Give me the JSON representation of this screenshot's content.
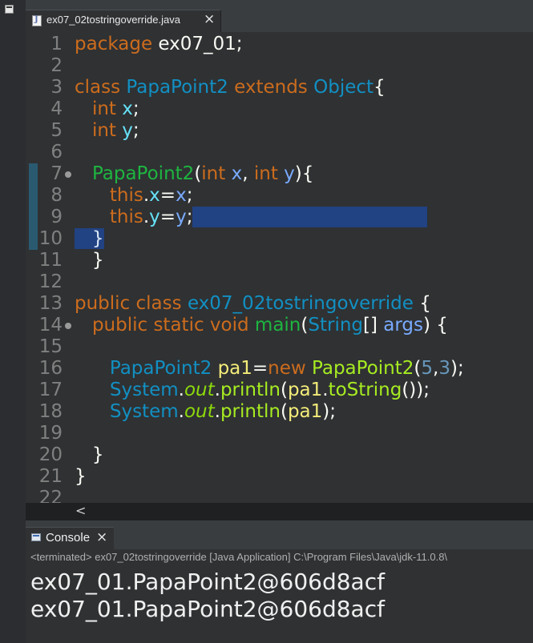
{
  "editor_tab": {
    "title": "ex07_02tostringoverride.java",
    "close": "×",
    "icon": "java-file-icon"
  },
  "code_lines": [
    {
      "n": "1",
      "t": [
        [
          "k",
          "package"
        ],
        [
          "p",
          " ex07_01;"
        ]
      ]
    },
    {
      "n": "2",
      "t": []
    },
    {
      "n": "3",
      "t": [
        [
          "k",
          "class"
        ],
        [
          "p",
          " "
        ],
        [
          "cl",
          "PapaPoint2"
        ],
        [
          "p",
          " "
        ],
        [
          "k",
          "extends"
        ],
        [
          "p",
          " "
        ],
        [
          "cl",
          "Object"
        ],
        [
          "p",
          "{"
        ]
      ]
    },
    {
      "n": "4",
      "t": [
        [
          "p",
          "   "
        ],
        [
          "k",
          "int"
        ],
        [
          "p",
          " "
        ],
        [
          "fd",
          "x"
        ],
        [
          "p",
          ";"
        ]
      ]
    },
    {
      "n": "5",
      "t": [
        [
          "p",
          "   "
        ],
        [
          "k",
          "int"
        ],
        [
          "p",
          " "
        ],
        [
          "fd",
          "y"
        ],
        [
          "p",
          ";"
        ]
      ]
    },
    {
      "n": "6",
      "t": []
    },
    {
      "n": "7",
      "t": [
        [
          "p",
          "   "
        ],
        [
          "fn",
          "PapaPoint2"
        ],
        [
          "p",
          "("
        ],
        [
          "k",
          "int"
        ],
        [
          "p",
          " "
        ],
        [
          "pm",
          "x"
        ],
        [
          "p",
          ", "
        ],
        [
          "k",
          "int"
        ],
        [
          "p",
          " "
        ],
        [
          "pm",
          "y"
        ],
        [
          "p",
          "){"
        ]
      ]
    },
    {
      "n": "8",
      "t": [
        [
          "p",
          "      "
        ],
        [
          "k",
          "this"
        ],
        [
          "p",
          "."
        ],
        [
          "fd",
          "x"
        ],
        [
          "p",
          "="
        ],
        [
          "pm",
          "x"
        ],
        [
          "p",
          ";"
        ]
      ]
    },
    {
      "n": "9",
      "t": [
        [
          "p",
          "      "
        ],
        [
          "k",
          "this"
        ],
        [
          "p",
          "."
        ],
        [
          "fd",
          "y"
        ],
        [
          "p",
          "="
        ],
        [
          "pm",
          "y"
        ],
        [
          "p",
          ";"
        ]
      ]
    },
    {
      "n": "10",
      "t": [
        [
          "p",
          "   }"
        ]
      ]
    },
    {
      "n": "11",
      "t": [
        [
          "p",
          "   }"
        ]
      ]
    },
    {
      "n": "12",
      "t": []
    },
    {
      "n": "13",
      "t": [
        [
          "k",
          "public"
        ],
        [
          "p",
          " "
        ],
        [
          "k",
          "class"
        ],
        [
          "p",
          " "
        ],
        [
          "cl",
          "ex07_02tostringoverride"
        ],
        [
          "p",
          " {"
        ]
      ]
    },
    {
      "n": "14",
      "t": [
        [
          "p",
          "   "
        ],
        [
          "k",
          "public"
        ],
        [
          "p",
          " "
        ],
        [
          "k",
          "static"
        ],
        [
          "p",
          " "
        ],
        [
          "k",
          "void"
        ],
        [
          "p",
          " "
        ],
        [
          "fn",
          "main"
        ],
        [
          "p",
          "("
        ],
        [
          "cl",
          "String"
        ],
        [
          "p",
          "[] "
        ],
        [
          "pm",
          "args"
        ],
        [
          "p",
          ") {"
        ]
      ]
    },
    {
      "n": "15",
      "t": []
    },
    {
      "n": "16",
      "t": [
        [
          "p",
          "      "
        ],
        [
          "cl",
          "PapaPoint2"
        ],
        [
          "p",
          " "
        ],
        [
          "v",
          "pa1"
        ],
        [
          "p",
          "="
        ],
        [
          "k",
          "new"
        ],
        [
          "p",
          " "
        ],
        [
          "mt",
          "PapaPoint2"
        ],
        [
          "p",
          "("
        ],
        [
          "n",
          "5"
        ],
        [
          "p",
          ","
        ],
        [
          "n",
          "3"
        ],
        [
          "p",
          ");"
        ]
      ]
    },
    {
      "n": "17",
      "t": [
        [
          "p",
          "      "
        ],
        [
          "cl",
          "System"
        ],
        [
          "p",
          "."
        ],
        [
          "st",
          "out"
        ],
        [
          "p",
          "."
        ],
        [
          "mt",
          "println"
        ],
        [
          "p",
          "("
        ],
        [
          "v",
          "pa1"
        ],
        [
          "p",
          "."
        ],
        [
          "mt",
          "toString"
        ],
        [
          "p",
          "());"
        ]
      ]
    },
    {
      "n": "18",
      "t": [
        [
          "p",
          "      "
        ],
        [
          "cl",
          "System"
        ],
        [
          "p",
          "."
        ],
        [
          "st",
          "out"
        ],
        [
          "p",
          "."
        ],
        [
          "mt",
          "println"
        ],
        [
          "p",
          "("
        ],
        [
          "v",
          "pa1"
        ],
        [
          "p",
          ");"
        ]
      ]
    },
    {
      "n": "19",
      "t": []
    },
    {
      "n": "20",
      "t": [
        [
          "p",
          "   }"
        ]
      ]
    },
    {
      "n": "21",
      "t": [
        [
          "p",
          "}"
        ]
      ]
    },
    {
      "n": "22",
      "t": []
    }
  ],
  "fold_lines": [
    "7",
    "14"
  ],
  "marked_lines": [
    "7",
    "8",
    "9",
    "10"
  ],
  "scroll_arrow": "<",
  "console_tab": {
    "title": "Console",
    "close": "×",
    "icon": "console-icon"
  },
  "console": {
    "status": "<terminated> ex07_02tostringoverride [Java Application] C:\\Program Files\\Java\\jdk-11.0.8\\",
    "output": [
      "ex07_01.PapaPoint2@606d8acf",
      "ex07_01.PapaPoint2@606d8acf"
    ]
  },
  "colors": {
    "keyword": "#cc6c1d",
    "class": "#1290c3",
    "method_decl": "#1eb540",
    "field": "#66e1f8",
    "param": "#79abff",
    "method_call": "#a7ec21",
    "number": "#6897bb",
    "local_var": "#f3ec79",
    "selection": "#214283",
    "background": "#2f3133"
  }
}
